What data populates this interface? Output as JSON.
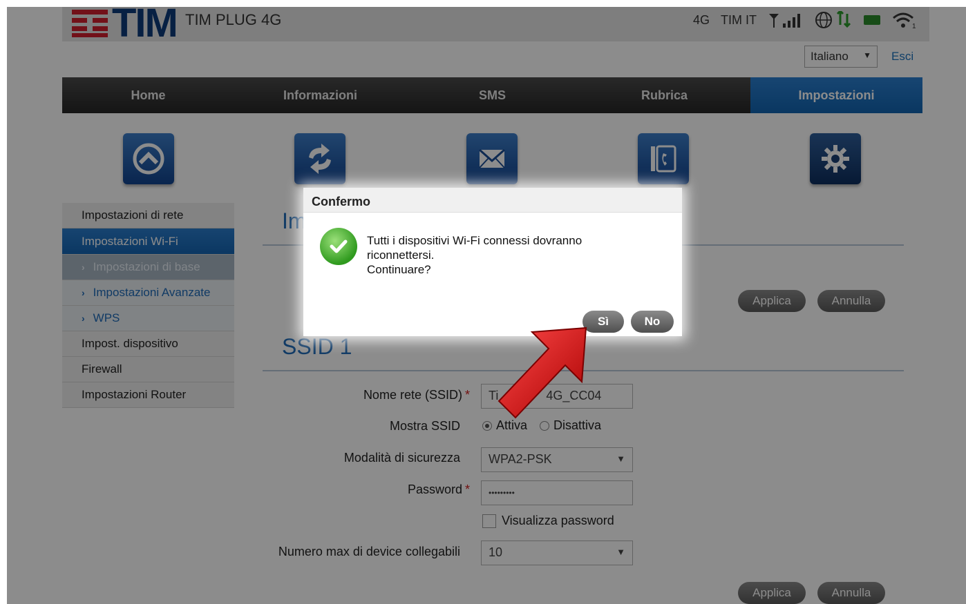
{
  "header": {
    "logo_text": "TIM",
    "product_name": "TIM PLUG 4G",
    "status": {
      "network_type": "4G",
      "operator": "TIM IT",
      "icons": [
        "signal-icon",
        "globe-data-icon",
        "sim-icon",
        "wifi-icon"
      ]
    }
  },
  "language": {
    "selected": "Italiano"
  },
  "logout_label": "Esci",
  "nav": {
    "items": [
      {
        "label": "Home",
        "icon": "network-icon"
      },
      {
        "label": "Informazioni",
        "icon": "refresh-icon"
      },
      {
        "label": "SMS",
        "icon": "envelope-icon"
      },
      {
        "label": "Rubrica",
        "icon": "phonebook-icon"
      },
      {
        "label": "Impostazioni",
        "icon": "gear-icon"
      }
    ],
    "active": "Impostazioni"
  },
  "sidebar": {
    "items": [
      {
        "label": "Impostazioni di rete"
      },
      {
        "label": "Impostazioni Wi-Fi"
      },
      {
        "label": "Impostazioni di base"
      },
      {
        "label": "Impostazioni Avanzate"
      },
      {
        "label": "WPS"
      },
      {
        "label": "Impost. dispositivo"
      },
      {
        "label": "Firewall"
      },
      {
        "label": "Impostazioni Router"
      }
    ]
  },
  "content": {
    "title_visible": "Im",
    "apply_label": "Applica",
    "cancel_label": "Annulla",
    "ssid_title": "SSID 1",
    "form": {
      "ssid_label": "Nome rete (SSID)",
      "ssid_value": "TIM PLUG 4G_CC04",
      "ssid_visible_start": "Ti",
      "ssid_visible_end": "4G_CC04",
      "broadcast_label": "Mostra SSID",
      "broadcast_on": "Attiva",
      "broadcast_off": "Disattiva",
      "security_label": "Modalità di sicurezza",
      "security_value": "WPA2-PSK",
      "password_label": "Password",
      "password_value": "•••••••••",
      "show_password_label": "Visualizza password",
      "max_devices_label": "Numero max di device collegabili",
      "max_devices_value": "10",
      "required_mark": "*"
    }
  },
  "dialog": {
    "title": "Confermo",
    "message_lines": [
      "Tutti i dispositivi Wi-Fi connessi dovranno",
      "riconnettersi.",
      "Continuare?"
    ],
    "yes_label": "Sì",
    "no_label": "No",
    "icon": "checkmark-icon"
  },
  "colors": {
    "brand_blue": "#0d3b7a",
    "brand_red": "#d01f2e",
    "accent_blue": "#1e6bb8",
    "success_green": "#2f9a1e",
    "arrow_red": "#d81010"
  }
}
